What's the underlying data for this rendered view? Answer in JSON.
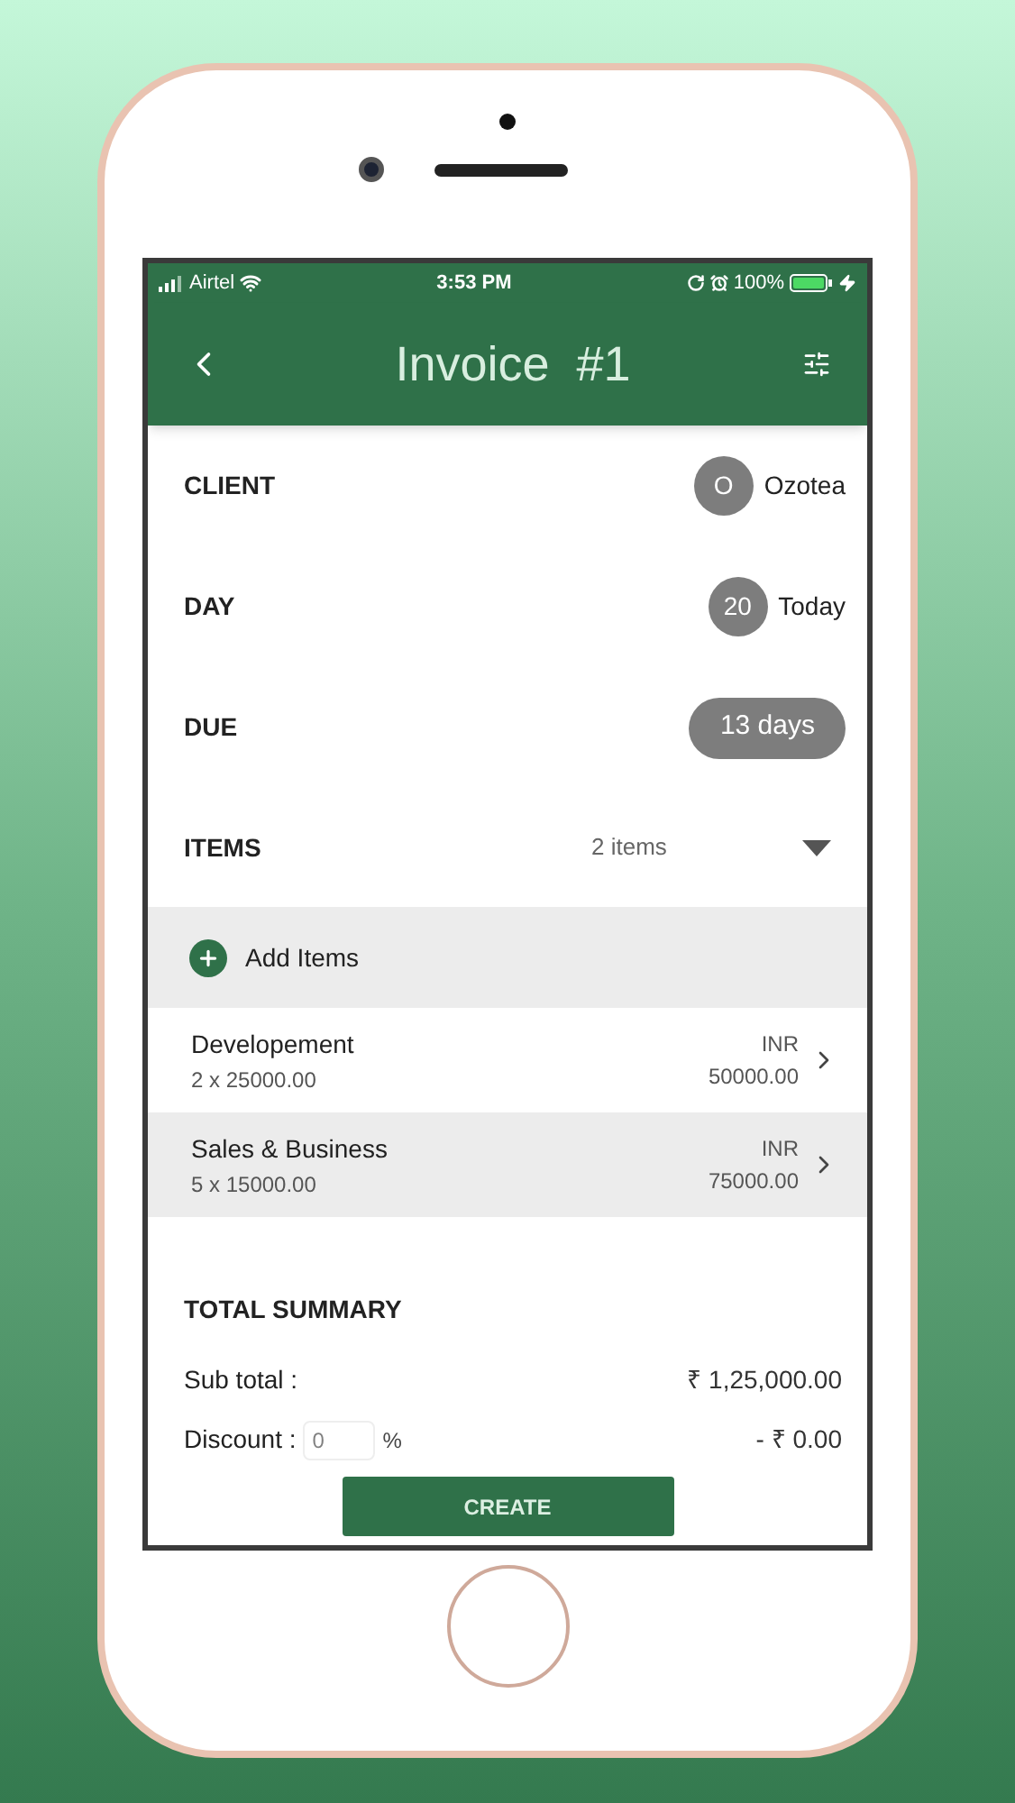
{
  "status_bar": {
    "carrier": "Airtel",
    "time": "3:53 PM",
    "battery": "100%"
  },
  "header": {
    "title": "Invoice  #1"
  },
  "fields": [
    {
      "label": "CLIENT",
      "kind": "avatar",
      "badge": "O",
      "value": "Ozotea"
    },
    {
      "label": "DAY",
      "kind": "avatar",
      "badge": "20",
      "value": "Today"
    },
    {
      "label": "DUE",
      "kind": "pill",
      "badge": "13 days"
    }
  ],
  "items": {
    "label": "ITEMS",
    "count": "2 items",
    "expanded": true,
    "add_label": "Add Items",
    "rows": [
      {
        "name": "Developement",
        "qty": "2 x 25000.00",
        "currency": "INR",
        "amount": "50000.00",
        "selected": false
      },
      {
        "name": "Sales & Business",
        "qty": "5 x 15000.00",
        "currency": "INR",
        "amount": "75000.00",
        "selected": true
      }
    ]
  },
  "summary": {
    "title": "TOTAL SUMMARY",
    "rows": [
      {
        "kind": "plain",
        "label": "Sub total :",
        "value": "₹ 1,25,000.00"
      },
      {
        "kind": "input",
        "label": "Discount :",
        "placeholder": "0",
        "unit": "%",
        "value": "- ₹ 0.00"
      }
    ]
  },
  "create_button": "CREATE"
}
